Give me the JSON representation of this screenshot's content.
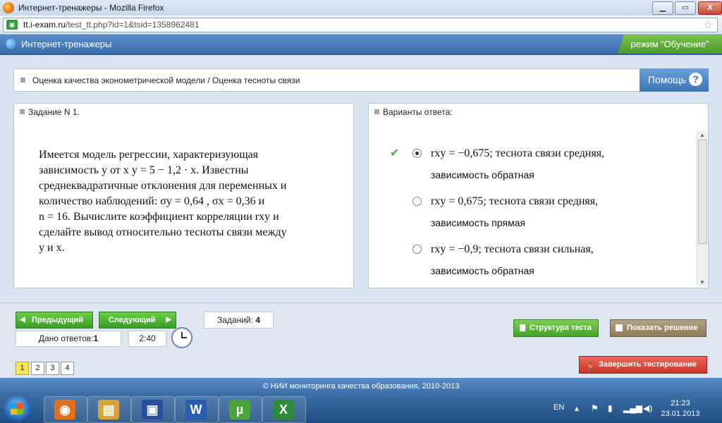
{
  "window": {
    "title": "Интернет-тренажеры - Mozilla Firefox",
    "controls": {
      "minimize": "▁",
      "maximize": "▭",
      "close": "X"
    }
  },
  "browser": {
    "url_host": "tt.i-exam.ru",
    "url_path": "/test_tt.php?id=1&tsid=1358962481",
    "bookmark_star": "☆"
  },
  "app": {
    "title": "Интернет-тренажеры",
    "mode_label": "режим “Обучение”"
  },
  "topic": {
    "text": "Оценка качества эконометрической модели / Оценка тесноты связи",
    "help_label": "Помощь",
    "help_icon": "?"
  },
  "task": {
    "header": "Задание N 1.",
    "lines": [
      "Имеется модель регрессии, характеризующая",
      "зависимость y от x  y = 5 − 1,2 · x. Известны",
      "среднеквадратичные отклонения для переменных и",
      "количество наблюдений: σy = 0,64 , σx = 0,36  и",
      "n = 16. Вычислите коэффициент корреляции rxy и",
      "сделайте вывод относительно тесноты связи между",
      "y и x."
    ]
  },
  "answers": {
    "header": "Варианты ответа:",
    "options": [
      {
        "line1": "rxy = −0,675;  теснота связи средняя,",
        "line2": "зависимость обратная",
        "selected": true,
        "checked": true
      },
      {
        "line1": "rxy = 0,675;  теснота связи средняя,",
        "line2": "зависимость прямая",
        "selected": false,
        "checked": false
      },
      {
        "line1": "rxy = −0,9;  теснота связи сильная,",
        "line2": "зависимость обратная",
        "selected": false,
        "checked": false
      }
    ]
  },
  "navigation": {
    "prev_label": "Предыдущий",
    "next_label": "Следующий",
    "answered_label": "Дано ответов:",
    "answered_count": "1",
    "timer": "2:40",
    "tasks_label": "Заданий:",
    "tasks_count": "4",
    "pages": [
      "1",
      "2",
      "3",
      "4"
    ],
    "active_page": "1"
  },
  "actions": {
    "structure_label": "Структура теста",
    "solution_label": "Показать решение",
    "finish_label": "Завершить тестирование"
  },
  "footer": {
    "text": "© НИИ мониторинга качества образования, 2010-2013"
  },
  "taskbar": {
    "lang": "EN",
    "time": "21:23",
    "date": "23.01.2013",
    "apps": [
      {
        "icon": "firefox-icon",
        "glyph": "◉",
        "color": "#e0701e"
      },
      {
        "icon": "explorer-icon",
        "glyph": "▤",
        "color": "#d9a33a"
      },
      {
        "icon": "save-icon",
        "glyph": "▣",
        "color": "#2a4f9a"
      },
      {
        "icon": "word-icon",
        "glyph": "W",
        "color": "#2b5cad"
      },
      {
        "icon": "utorrent-icon",
        "glyph": "µ",
        "color": "#4aa43a"
      },
      {
        "icon": "excel-icon",
        "glyph": "X",
        "color": "#2f8a3a"
      }
    ]
  }
}
